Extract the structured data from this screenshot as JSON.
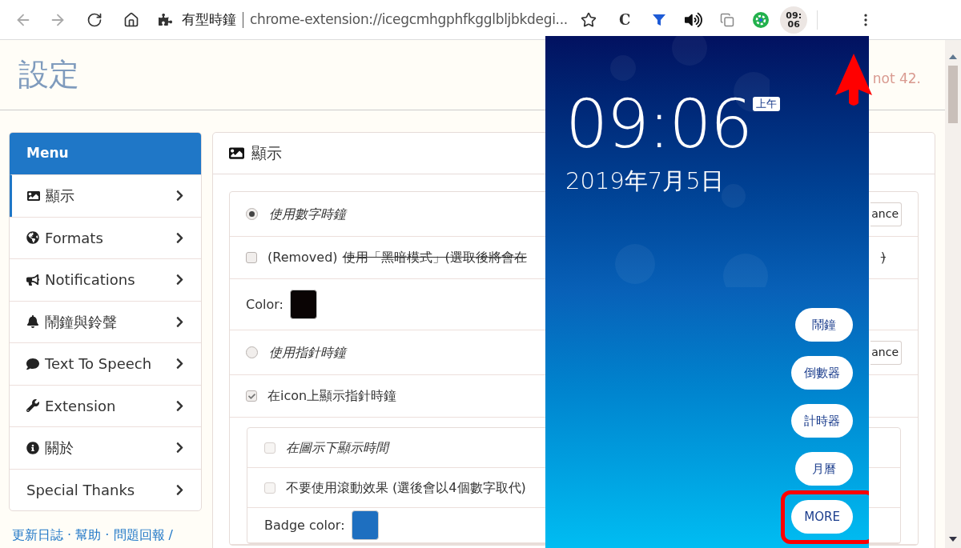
{
  "browser": {
    "page_title": "有型時鐘",
    "url": "chrome-extension://icegcmhgphfkgglbljbkdegi...",
    "ext_letter": "C",
    "clock_badge": [
      "09:",
      "06"
    ]
  },
  "page": {
    "title": "設定",
    "notice": "not 42."
  },
  "menu": {
    "title": "Menu",
    "items": [
      {
        "label": "顯示",
        "selected": true
      },
      {
        "label": "Formats",
        "selected": false
      },
      {
        "label": "Notifications",
        "selected": false
      },
      {
        "label": "鬧鐘與鈴聲",
        "selected": false
      },
      {
        "label": "Text To Speech",
        "selected": false
      },
      {
        "label": "Extension",
        "selected": false
      },
      {
        "label": "關於",
        "selected": false
      },
      {
        "label": "Special Thanks",
        "selected": false
      }
    ]
  },
  "footer_links": "更新日誌 · 幫助 · 問題回報 /",
  "panel": {
    "title": "顯示",
    "rows": [
      {
        "kind": "radio",
        "label": "使用數字時鐘",
        "italic": true,
        "selected": true,
        "button": "ance"
      },
      {
        "kind": "checkbox",
        "label": "(Removed)",
        "struck": "使用「黑暗模式」(選取後將會在",
        "struck_end": ")",
        "italic": false,
        "checked": false
      },
      {
        "kind": "color",
        "label": "Color:",
        "color": "#0a0404"
      },
      {
        "kind": "radio",
        "label": "使用指針時鐘",
        "italic": true,
        "selected": false,
        "button": "ance"
      },
      {
        "kind": "checkbox",
        "label": "在icon上顯示指針時鐘",
        "italic": false,
        "checked": true
      },
      {
        "kind": "group",
        "rows": [
          {
            "kind": "checkbox",
            "label": "在圖示下顯示時間",
            "italic": true,
            "checked": false
          },
          {
            "kind": "checkbox",
            "label": "不要使用滾動效果 (選後會以4個數字取代)",
            "italic": false,
            "checked": false
          },
          {
            "kind": "color",
            "label": "Badge color:",
            "color": "#1e6fc0"
          }
        ]
      }
    ]
  },
  "popup": {
    "time": "09:06",
    "meridiem": "上午",
    "date": "2019年7月5日",
    "buttons": [
      {
        "label": "鬧鐘",
        "highlighted": false
      },
      {
        "label": "倒數器",
        "highlighted": false
      },
      {
        "label": "計時器",
        "highlighted": false
      },
      {
        "label": "月曆",
        "highlighted": false
      },
      {
        "label": "MORE",
        "highlighted": true
      }
    ]
  }
}
